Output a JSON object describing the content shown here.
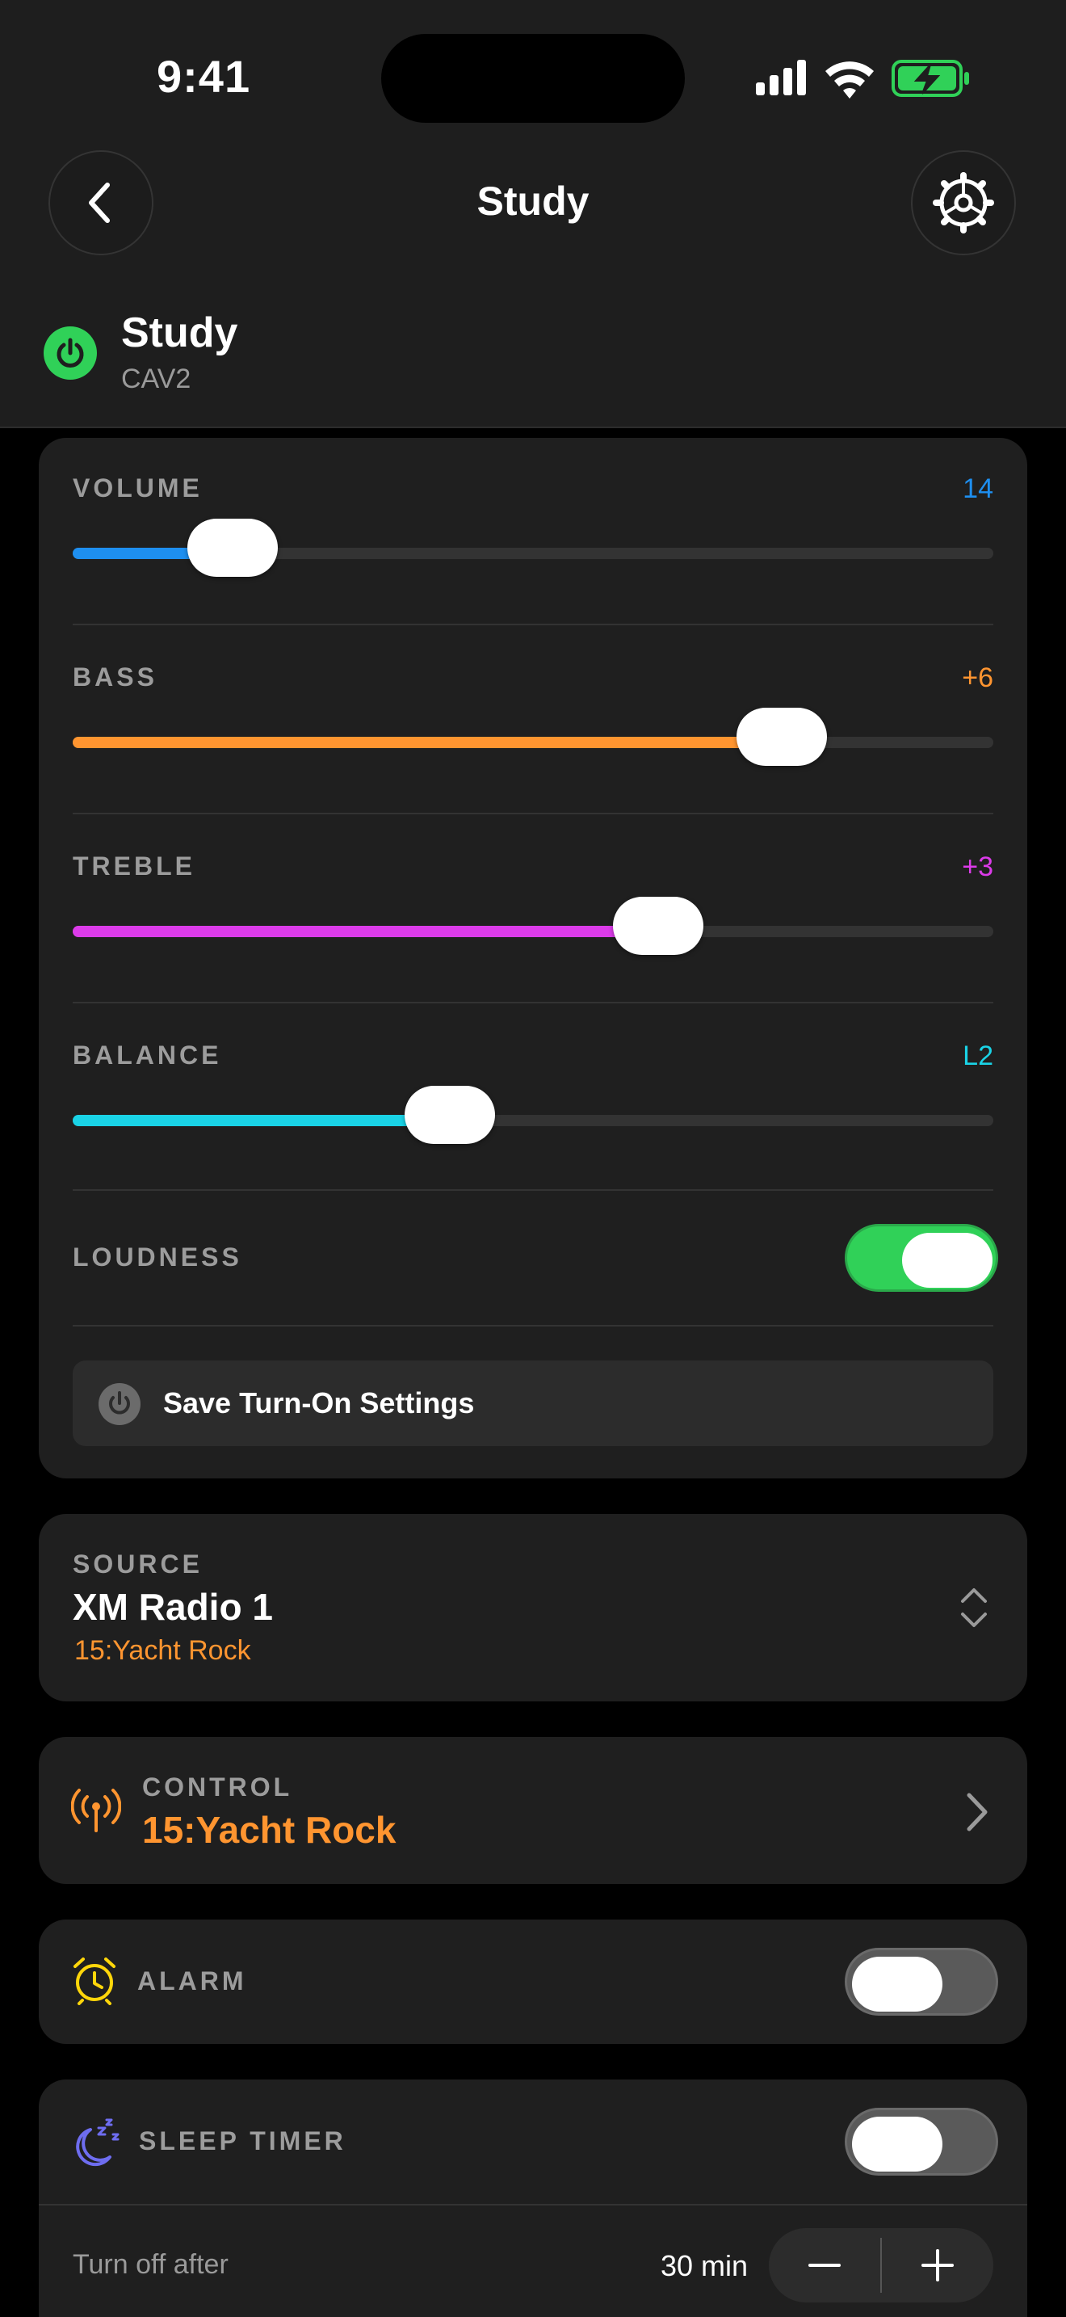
{
  "status_bar": {
    "time": "9:41"
  },
  "nav": {
    "title": "Study"
  },
  "zone": {
    "name": "Study",
    "model": "CAV2",
    "power": "on"
  },
  "audio": {
    "volume": {
      "label": "VOLUME",
      "value": "14",
      "level": 0.174,
      "color": "#1e8ff0"
    },
    "bass": {
      "label": "BASS",
      "value": "+6",
      "level": 0.77,
      "color": "#ff9530"
    },
    "treble": {
      "label": "TREBLE",
      "value": "+3",
      "level": 0.636,
      "color": "#dc3bea"
    },
    "balance": {
      "label": "BALANCE",
      "value": "L2",
      "level": 0.41,
      "color": "#1ad3e6"
    },
    "loudness": {
      "label": "LOUDNESS",
      "on": true
    },
    "save_label": "Save Turn-On Settings"
  },
  "source": {
    "label": "SOURCE",
    "name": "XM Radio 1",
    "detail": "15:Yacht Rock"
  },
  "control": {
    "label": "CONTROL",
    "value": "15:Yacht Rock"
  },
  "alarm": {
    "label": "ALARM",
    "on": false
  },
  "sleep_timer": {
    "label": "SLEEP TIMER",
    "on": false,
    "turn_off_label": "Turn off after",
    "duration": "30 min"
  },
  "colors": {
    "accent_orange": "#ff9530",
    "green": "#30d158",
    "alarm_yellow": "#ffd60a",
    "sleep_purple": "#6e6df0"
  }
}
